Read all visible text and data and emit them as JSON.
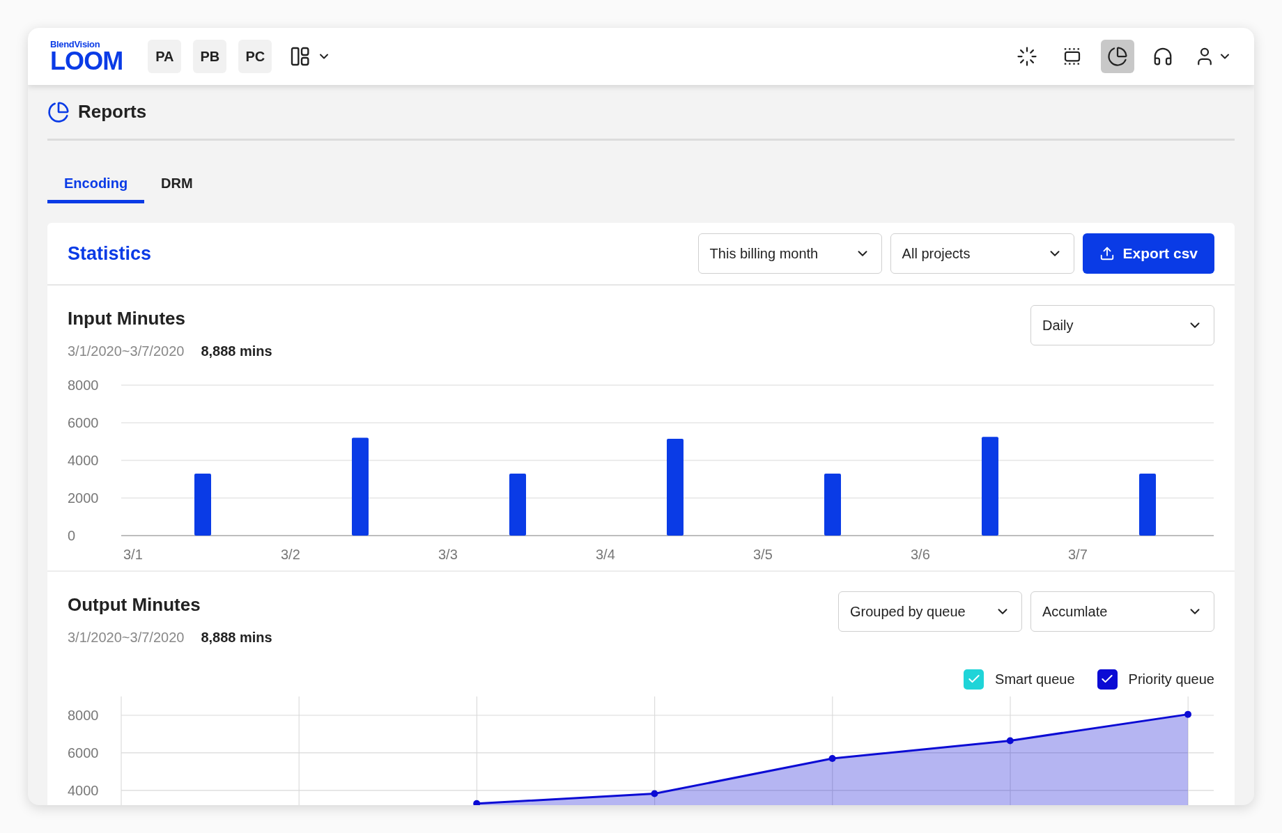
{
  "header": {
    "logo_brand": "BlendVision",
    "logo": "LOOM",
    "projects": [
      {
        "label": "PA"
      },
      {
        "label": "PB"
      },
      {
        "label": "PC"
      }
    ],
    "nav_buttons": [
      {
        "selected": false
      },
      {
        "selected": false
      },
      {
        "selected": true
      },
      {
        "selected": false
      }
    ]
  },
  "page": {
    "title": "Reports",
    "tabs": [
      {
        "label": "Encoding",
        "selected": true
      },
      {
        "label": "DRM",
        "selected": false
      }
    ]
  },
  "card": {
    "title": "Statistics",
    "filters": [
      {
        "value": "This billing month"
      },
      {
        "value": "All projects"
      }
    ],
    "export_button": "Export csv",
    "sections": [
      {
        "title": "Input Minutes",
        "range": "3/1/2020~3/7/2020",
        "total": "8,888 mins",
        "selects": [
          {
            "value": "Daily"
          }
        ],
        "chart_data": {
          "type": "bar",
          "categories": [
            "3/1",
            "3/2",
            "3/3",
            "3/4",
            "3/5",
            "3/6",
            "3/7"
          ],
          "values": [
            3300,
            5200,
            3300,
            5150,
            3300,
            5250,
            3300
          ],
          "ylim": [
            0,
            8000
          ],
          "yticks": [
            0,
            2000,
            4000,
            6000,
            8000
          ],
          "grid": true
        }
      },
      {
        "title": "Output Minutes",
        "range": "3/1/2020~3/7/2020",
        "total": "8,888 mins",
        "selects": [
          {
            "value": "Grouped by queue"
          },
          {
            "value": "Accumlate"
          }
        ],
        "legend": [
          {
            "checked": true
          },
          {
            "checked": true
          }
        ],
        "chart_data": {
          "type": "area",
          "series": [
            {
              "name": "Priority queue",
              "color": "#0b0bd4",
              "values": [
                3300,
                3830,
                5700,
                6650,
                8050
              ]
            },
            {
              "name": "Smart queue",
              "color": "#1fd4d8",
              "values": [
                null,
                null,
                null,
                null,
                null
              ]
            }
          ],
          "categories": [
            null,
            null,
            null,
            null,
            null
          ],
          "ylim": [
            2700,
            9000
          ],
          "yticks": [
            4000,
            6000,
            8000
          ],
          "grid": true
        }
      }
    ]
  }
}
